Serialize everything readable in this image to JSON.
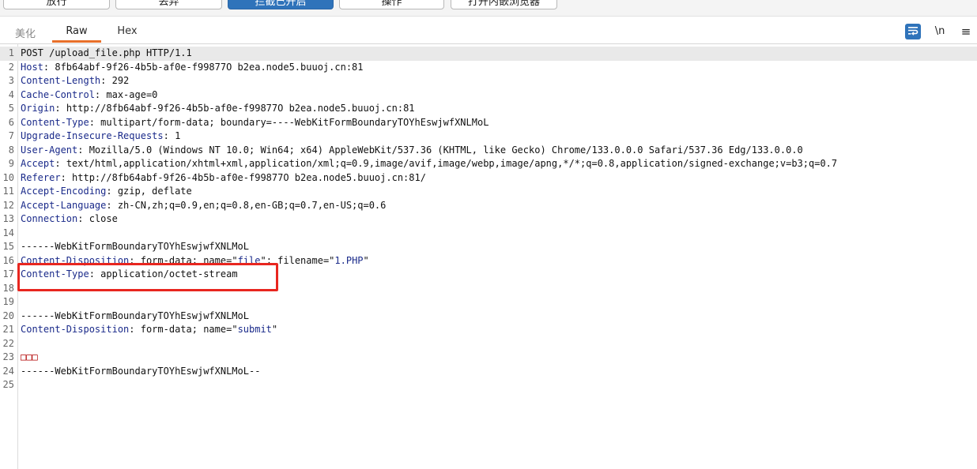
{
  "toolbar": {
    "buttons": [
      {
        "label": "放行",
        "active": false
      },
      {
        "label": "丢弃",
        "active": false
      },
      {
        "label": "拦截已开启",
        "active": true
      },
      {
        "label": "操作",
        "active": false
      },
      {
        "label": "打开内嵌浏览器",
        "active": false
      }
    ]
  },
  "tabs": {
    "items": [
      {
        "label": "美化",
        "active": false
      },
      {
        "label": "Raw",
        "active": true
      },
      {
        "label": "Hex",
        "active": false
      }
    ],
    "newline_label": "\\n",
    "menu_label": "≡"
  },
  "editor": {
    "lines": [
      {
        "n": "1",
        "name": "",
        "sep": "",
        "value": "POST /upload_file.php HTTP/1.1"
      },
      {
        "n": "2",
        "name": "Host",
        "sep": ": ",
        "value": "8fb64abf-9f26-4b5b-af0e-f99877O b2ea.node5.buuoj.cn:81"
      },
      {
        "n": "3",
        "name": "Content-Length",
        "sep": ": ",
        "value": "292"
      },
      {
        "n": "4",
        "name": "Cache-Control",
        "sep": ": ",
        "value": "max-age=0"
      },
      {
        "n": "5",
        "name": "Origin",
        "sep": ": ",
        "value": "http://8fb64abf-9f26-4b5b-af0e-f99877O b2ea.node5.buuoj.cn:81"
      },
      {
        "n": "6",
        "name": "Content-Type",
        "sep": ": ",
        "value": "multipart/form-data; boundary=----WebKitFormBoundaryTOYhEswjwfXNLMoL"
      },
      {
        "n": "7",
        "name": "Upgrade-Insecure-Requests",
        "sep": ": ",
        "value": "1"
      },
      {
        "n": "8",
        "name": "User-Agent",
        "sep": ": ",
        "value": "Mozilla/5.0 (Windows NT 10.0; Win64; x64) AppleWebKit/537.36 (KHTML, like Gecko) Chrome/133.0.0.0 Safari/537.36 Edg/133.0.0.0"
      },
      {
        "n": "9",
        "name": "Accept",
        "sep": ": ",
        "value": "text/html,application/xhtml+xml,application/xml;q=0.9,image/avif,image/webp,image/apng,*/*;q=0.8,application/signed-exchange;v=b3;q=0.7"
      },
      {
        "n": "10",
        "name": "Referer",
        "sep": ": ",
        "value": "http://8fb64abf-9f26-4b5b-af0e-f99877O b2ea.node5.buuoj.cn:81/"
      },
      {
        "n": "11",
        "name": "Accept-Encoding",
        "sep": ": ",
        "value": "gzip, deflate"
      },
      {
        "n": "12",
        "name": "Accept-Language",
        "sep": ": ",
        "value": "zh-CN,zh;q=0.9,en;q=0.8,en-GB;q=0.7,en-US;q=0.6"
      },
      {
        "n": "13",
        "name": "Connection",
        "sep": ": ",
        "value": "close"
      },
      {
        "n": "14",
        "name": "",
        "sep": "",
        "value": ""
      },
      {
        "n": "15",
        "name": "",
        "sep": "",
        "value": "------WebKitFormBoundaryTOYhEswjwfXNLMoL"
      },
      {
        "n": "16",
        "name": "Content-Disposition",
        "sep": ": ",
        "value": "form-data; name=\"",
        "s1": "file",
        "mid": "\"; filename=\"",
        "s2": "1.PHP",
        "end": "\""
      },
      {
        "n": "17",
        "name": "Content-Type",
        "sep": ": ",
        "value": "application/octet-stream"
      },
      {
        "n": "18",
        "name": "",
        "sep": "",
        "value": ""
      },
      {
        "n": "19",
        "name": "",
        "sep": "",
        "value": ""
      },
      {
        "n": "20",
        "name": "",
        "sep": "",
        "value": "------WebKitFormBoundaryTOYhEswjwfXNLMoL"
      },
      {
        "n": "21",
        "name": "Content-Disposition",
        "sep": ": ",
        "value": "form-data; name=\"",
        "s1": "submit",
        "mid": "\"",
        "s2": "",
        "end": ""
      },
      {
        "n": "22",
        "name": "",
        "sep": "",
        "value": ""
      },
      {
        "n": "23",
        "name": "",
        "sep": "",
        "value": "",
        "garbled": "□□□"
      },
      {
        "n": "24",
        "name": "",
        "sep": "",
        "value": "------WebKitFormBoundaryTOYhEswjwfXNLMoL--"
      },
      {
        "n": "25",
        "name": "",
        "sep": "",
        "value": ""
      }
    ]
  },
  "colors": {
    "header_name": "#1a2a8a",
    "accent_tab": "#e8702a",
    "active_button": "#2f73ba",
    "highlight_border": "#e8261f",
    "garbled": "#b00000"
  }
}
